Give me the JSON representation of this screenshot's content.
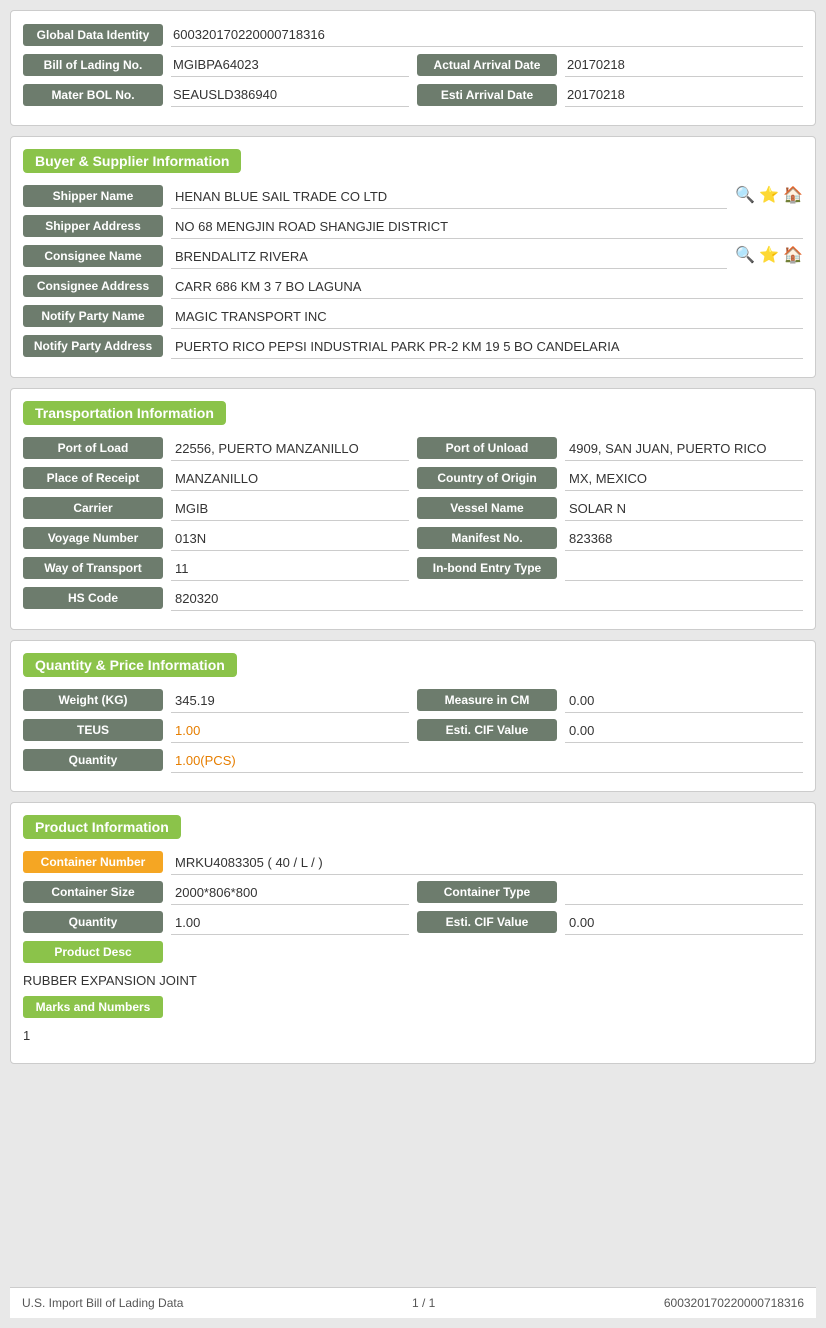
{
  "identity": {
    "global_data_label": "Global Data Identity",
    "global_data_value": "600320170220000718316",
    "bol_label": "Bill of Lading No.",
    "bol_value": "MGIBPA64023",
    "actual_arrival_label": "Actual Arrival Date",
    "actual_arrival_value": "20170218",
    "master_bol_label": "Mater BOL No.",
    "master_bol_value": "SEAUSLD386940",
    "esti_arrival_label": "Esti Arrival Date",
    "esti_arrival_value": "20170218"
  },
  "buyer_supplier": {
    "header": "Buyer & Supplier Information",
    "shipper_name_label": "Shipper Name",
    "shipper_name_value": "HENAN BLUE SAIL TRADE CO LTD",
    "shipper_address_label": "Shipper Address",
    "shipper_address_value": "NO 68 MENGJIN ROAD SHANGJIE DISTRICT",
    "consignee_name_label": "Consignee Name",
    "consignee_name_value": "BRENDALITZ RIVERA",
    "consignee_address_label": "Consignee Address",
    "consignee_address_value": "CARR 686 KM 3 7 BO LAGUNA",
    "notify_party_name_label": "Notify Party Name",
    "notify_party_name_value": "MAGIC TRANSPORT INC",
    "notify_party_address_label": "Notify Party Address",
    "notify_party_address_value": "PUERTO RICO PEPSI INDUSTRIAL PARK PR-2 KM 19 5 BO CANDELARIA"
  },
  "transportation": {
    "header": "Transportation Information",
    "port_of_load_label": "Port of Load",
    "port_of_load_value": "22556, PUERTO MANZANILLO",
    "port_of_unload_label": "Port of Unload",
    "port_of_unload_value": "4909, SAN JUAN, PUERTO RICO",
    "place_of_receipt_label": "Place of Receipt",
    "place_of_receipt_value": "MANZANILLO",
    "country_of_origin_label": "Country of Origin",
    "country_of_origin_value": "MX, MEXICO",
    "carrier_label": "Carrier",
    "carrier_value": "MGIB",
    "vessel_name_label": "Vessel Name",
    "vessel_name_value": "SOLAR N",
    "voyage_number_label": "Voyage Number",
    "voyage_number_value": "013N",
    "manifest_no_label": "Manifest No.",
    "manifest_no_value": "823368",
    "way_of_transport_label": "Way of Transport",
    "way_of_transport_value": "11",
    "in_bond_entry_label": "In-bond Entry Type",
    "in_bond_entry_value": "",
    "hs_code_label": "HS Code",
    "hs_code_value": "820320"
  },
  "quantity_price": {
    "header": "Quantity & Price Information",
    "weight_label": "Weight (KG)",
    "weight_value": "345.19",
    "measure_label": "Measure in CM",
    "measure_value": "0.00",
    "teus_label": "TEUS",
    "teus_value": "1.00",
    "esti_cif_label": "Esti. CIF Value",
    "esti_cif_value": "0.00",
    "quantity_label": "Quantity",
    "quantity_value": "1.00(PCS)"
  },
  "product": {
    "header": "Product Information",
    "container_number_label": "Container Number",
    "container_number_value": "MRKU4083305 ( 40 / L / )",
    "container_size_label": "Container Size",
    "container_size_value": "2000*806*800",
    "container_type_label": "Container Type",
    "container_type_value": "",
    "quantity_label": "Quantity",
    "quantity_value": "1.00",
    "esti_cif_label": "Esti. CIF Value",
    "esti_cif_value": "0.00",
    "product_desc_label": "Product Desc",
    "product_desc_value": "RUBBER EXPANSION JOINT",
    "marks_label": "Marks and Numbers",
    "marks_value": "1"
  },
  "footer": {
    "left": "U.S. Import Bill of Lading Data",
    "center": "1 / 1",
    "right": "600320170220000718316"
  },
  "icons": {
    "search": "🔍",
    "star": "⭐",
    "home": "🏠"
  }
}
